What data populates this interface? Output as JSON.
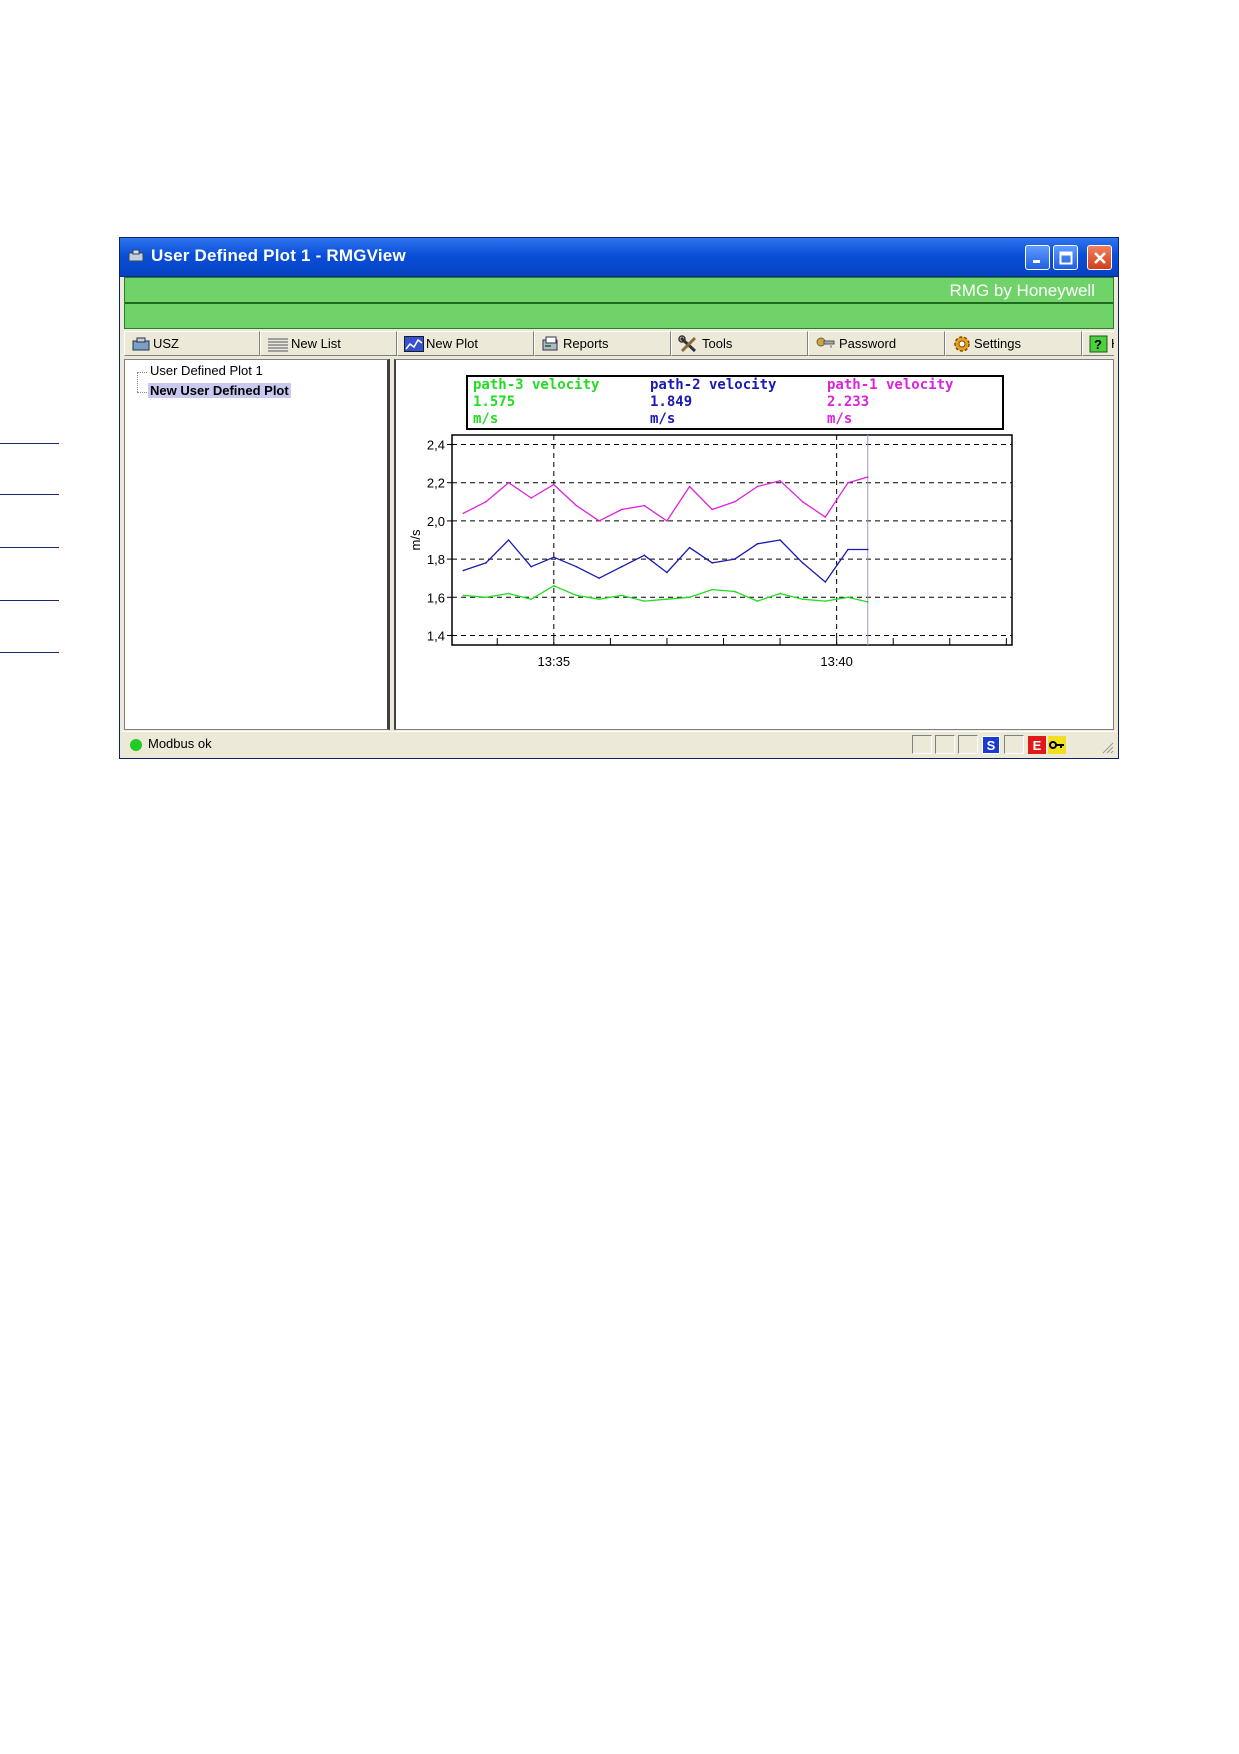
{
  "window": {
    "title": "User Defined Plot 1 - RMGView",
    "brand": "RMG by Honeywell"
  },
  "toolbar": {
    "buttons": [
      {
        "label": "USZ",
        "icon": "device-icon"
      },
      {
        "label": "New List",
        "icon": "list-icon"
      },
      {
        "label": "New Plot",
        "icon": "plot-icon"
      },
      {
        "label": "Reports",
        "icon": "report-icon"
      },
      {
        "label": "Tools",
        "icon": "tools-icon"
      },
      {
        "label": "Password",
        "icon": "key-icon"
      },
      {
        "label": "Settings",
        "icon": "gear-icon"
      },
      {
        "label": "H",
        "icon": "help-icon"
      }
    ]
  },
  "tree": {
    "items": [
      {
        "label": "User Defined Plot 1",
        "selected": false
      },
      {
        "label": "New User Defined Plot",
        "selected": true
      }
    ]
  },
  "legend": [
    {
      "name": "path-3 velocity",
      "value": "1.575",
      "unit": "m/s",
      "color": "#22dd22"
    },
    {
      "name": "path-2 velocity",
      "value": "1.849",
      "unit": "m/s",
      "color": "#1a1ab0"
    },
    {
      "name": "path-1 velocity",
      "value": "2.233",
      "unit": "m/s",
      "color": "#dd22dd"
    }
  ],
  "chart_data": {
    "type": "line",
    "ylabel": "m/s",
    "xlabel": "",
    "ylim": [
      1.35,
      2.45
    ],
    "yticks": [
      "1,4",
      "1,6",
      "1,8",
      "2,0",
      "2,2",
      "2,4"
    ],
    "ytick_values": [
      1.4,
      1.6,
      1.8,
      2.0,
      2.2,
      2.4
    ],
    "xticks": [
      "13:35",
      "13:40"
    ],
    "xtick_minutes": [
      35,
      40
    ],
    "xlim_minutes": [
      33.2,
      43.1
    ],
    "cursor_minute": 40.55,
    "grid": true,
    "x_minutes": [
      33.4,
      33.8,
      34.2,
      34.6,
      35.0,
      35.4,
      35.8,
      36.2,
      36.6,
      37.0,
      37.4,
      37.8,
      38.2,
      38.6,
      39.0,
      39.4,
      39.8,
      40.2,
      40.55
    ],
    "series": [
      {
        "name": "path-1 velocity",
        "color": "#dd22dd",
        "values": [
          2.04,
          2.1,
          2.2,
          2.12,
          2.19,
          2.08,
          2.0,
          2.06,
          2.08,
          2.0,
          2.18,
          2.06,
          2.1,
          2.18,
          2.21,
          2.1,
          2.02,
          2.2,
          2.23
        ]
      },
      {
        "name": "path-2 velocity",
        "color": "#1a1ab0",
        "values": [
          1.74,
          1.78,
          1.9,
          1.76,
          1.81,
          1.76,
          1.7,
          1.76,
          1.82,
          1.73,
          1.86,
          1.78,
          1.8,
          1.88,
          1.9,
          1.78,
          1.68,
          1.85,
          1.85
        ]
      },
      {
        "name": "path-3 velocity",
        "color": "#22dd22",
        "values": [
          1.61,
          1.6,
          1.62,
          1.59,
          1.66,
          1.61,
          1.59,
          1.61,
          1.58,
          1.59,
          1.6,
          1.64,
          1.63,
          1.58,
          1.62,
          1.59,
          1.58,
          1.6,
          1.575
        ]
      }
    ]
  },
  "status": {
    "text": "Modbus ok",
    "badge_s": "S",
    "badge_e": "E"
  }
}
